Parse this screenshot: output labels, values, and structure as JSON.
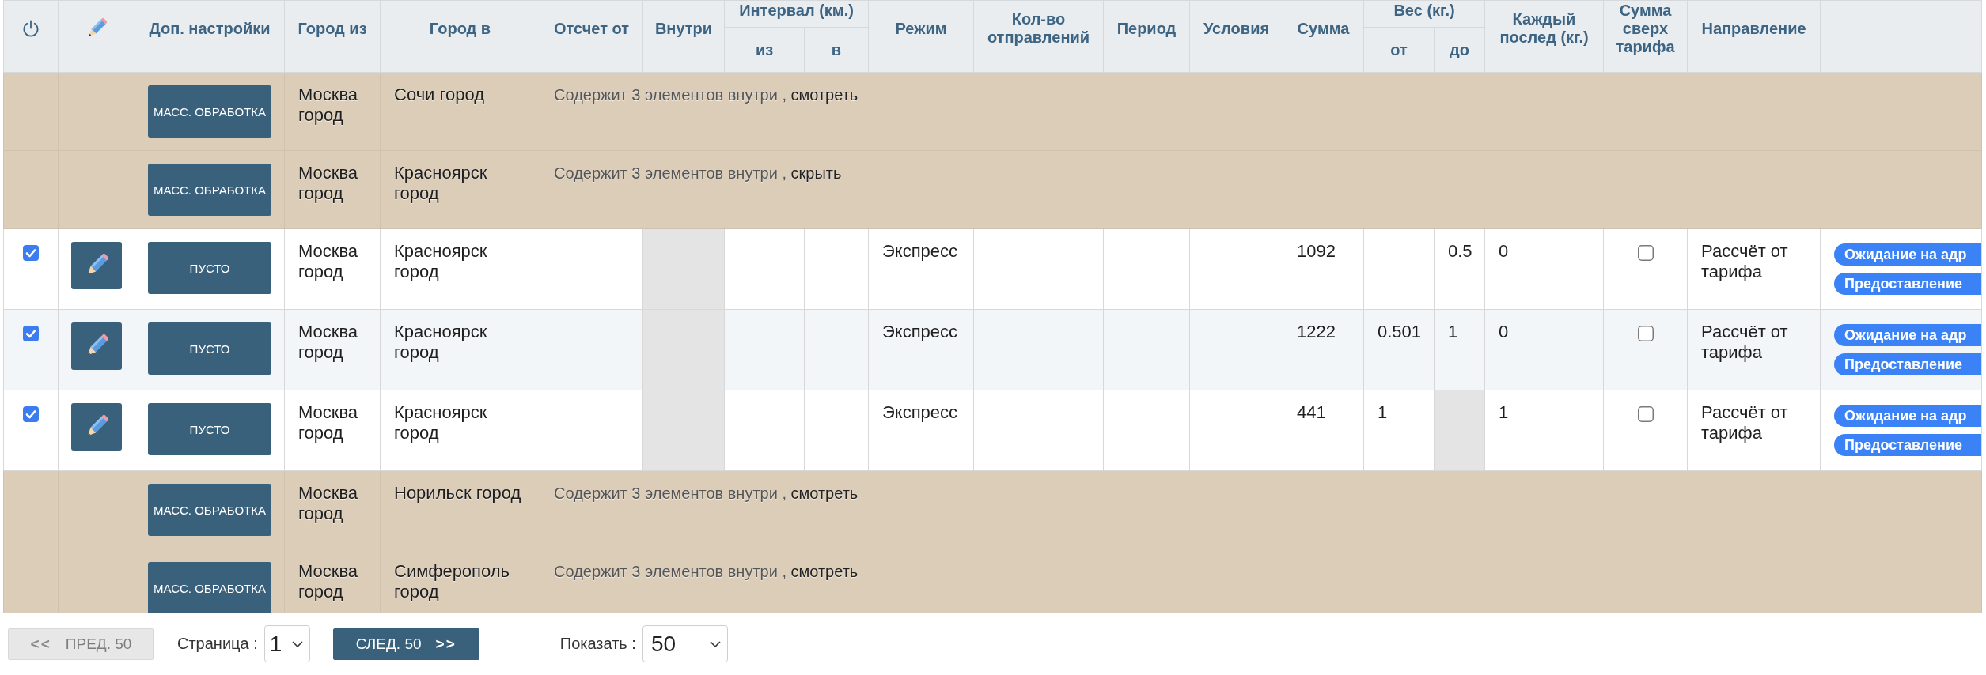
{
  "table": {
    "columns": [
      {
        "label": "Доп. настройки"
      },
      {
        "label": "Город из"
      },
      {
        "label": "Город в"
      },
      {
        "label": "Отсчет от"
      },
      {
        "label": "Внутри"
      },
      {
        "label": "Интервал (км.)",
        "children": [
          {
            "label": "из"
          },
          {
            "label": "в"
          }
        ]
      },
      {
        "label": "Режим"
      },
      {
        "label": "Кол-во отправлений"
      },
      {
        "label": "Период"
      },
      {
        "label": "Условия"
      },
      {
        "label": "Сумма"
      },
      {
        "label": "Вес (кг.)",
        "children": [
          {
            "label": "от"
          },
          {
            "label": "до"
          }
        ]
      },
      {
        "label": "Каждый послед (кг.)"
      },
      {
        "label": "Сумма сверх тарифа"
      },
      {
        "label": "Направление"
      }
    ],
    "rows": [
      {
        "kind": "group",
        "button": "МАСС. ОБРАБОТКА",
        "city_from": "Москва город",
        "city_to": "Сочи город",
        "summary": "Содержит 3 элементов внутри ,",
        "link": "смотреть"
      },
      {
        "kind": "group",
        "button": "МАСС. ОБРАБОТКА",
        "city_from": "Москва город",
        "city_to": "Красноярск город",
        "summary": "Содержит 3 элементов внутри ,",
        "link": "скрыть"
      },
      {
        "kind": "item",
        "checked": true,
        "button": "ПУСТО",
        "city_from": "Москва город",
        "city_to": "Красноярск город",
        "cells": [
          {
            "disabled": false
          },
          {
            "disabled": true
          },
          {
            "disabled": false
          },
          {
            "disabled": false
          },
          {
            "text": "Экспресс",
            "disabled": false
          },
          {
            "disabled": false
          },
          {
            "disabled": false
          },
          {
            "disabled": false
          },
          {
            "text": "1092",
            "disabled": false
          },
          {
            "disabled": false
          },
          {
            "text": "0.5",
            "disabled": false
          },
          {
            "text": "0",
            "disabled": false
          }
        ],
        "extra_charge": {
          "checked": false
        },
        "direction": "Рассчёт от тарифа",
        "tags": [
          "Ожидание на адр",
          "Предоставление"
        ]
      },
      {
        "kind": "item",
        "checked": true,
        "button": "ПУСТО",
        "city_from": "Москва город",
        "city_to": "Красноярск город",
        "cells": [
          {
            "disabled": false
          },
          {
            "disabled": true
          },
          {
            "disabled": false
          },
          {
            "disabled": false
          },
          {
            "text": "Экспресс",
            "disabled": false
          },
          {
            "disabled": false
          },
          {
            "disabled": false
          },
          {
            "disabled": false
          },
          {
            "text": "1222",
            "disabled": false
          },
          {
            "text": "0.501",
            "disabled": false
          },
          {
            "text": "1",
            "disabled": false
          },
          {
            "text": "0",
            "disabled": false
          }
        ],
        "extra_charge": {
          "checked": false
        },
        "direction": "Рассчёт от тарифа",
        "tags": [
          "Ожидание на адр",
          "Предоставление"
        ]
      },
      {
        "kind": "item",
        "checked": true,
        "button": "ПУСТО",
        "city_from": "Москва город",
        "city_to": "Красноярск город",
        "cells": [
          {
            "disabled": false
          },
          {
            "disabled": true
          },
          {
            "disabled": false
          },
          {
            "disabled": false
          },
          {
            "text": "Экспресс",
            "disabled": false
          },
          {
            "disabled": false
          },
          {
            "disabled": false
          },
          {
            "disabled": false
          },
          {
            "text": "441",
            "disabled": false
          },
          {
            "text": "1",
            "disabled": false
          },
          {
            "disabled": true
          },
          {
            "text": "1",
            "disabled": false
          }
        ],
        "extra_charge": {
          "checked": false
        },
        "direction": "Рассчёт от тарифа",
        "tags": [
          "Ожидание на адр",
          "Предоставление"
        ]
      },
      {
        "kind": "group",
        "button": "МАСС. ОБРАБОТКА",
        "city_from": "Москва город",
        "city_to": "Норильск город",
        "summary": "Содержит 3 элементов внутри ,",
        "link": "смотреть"
      },
      {
        "kind": "group",
        "button": "МАСС. ОБРАБОТКА",
        "city_from": "Москва город",
        "city_to": "Симферополь город",
        "summary": "Содержит 3 элементов внутри ,",
        "link": "смотреть"
      }
    ]
  },
  "pagination": {
    "prev": {
      "arrow": "<<",
      "label": "ПРЕД. 50",
      "disabled": true
    },
    "page_label": "Страница :",
    "page_select": {
      "value": "1"
    },
    "next": {
      "arrow": ">>",
      "label": "СЛЕД. 50",
      "disabled": false
    },
    "size_label": "Показать :",
    "size_select": {
      "value": "50"
    }
  }
}
